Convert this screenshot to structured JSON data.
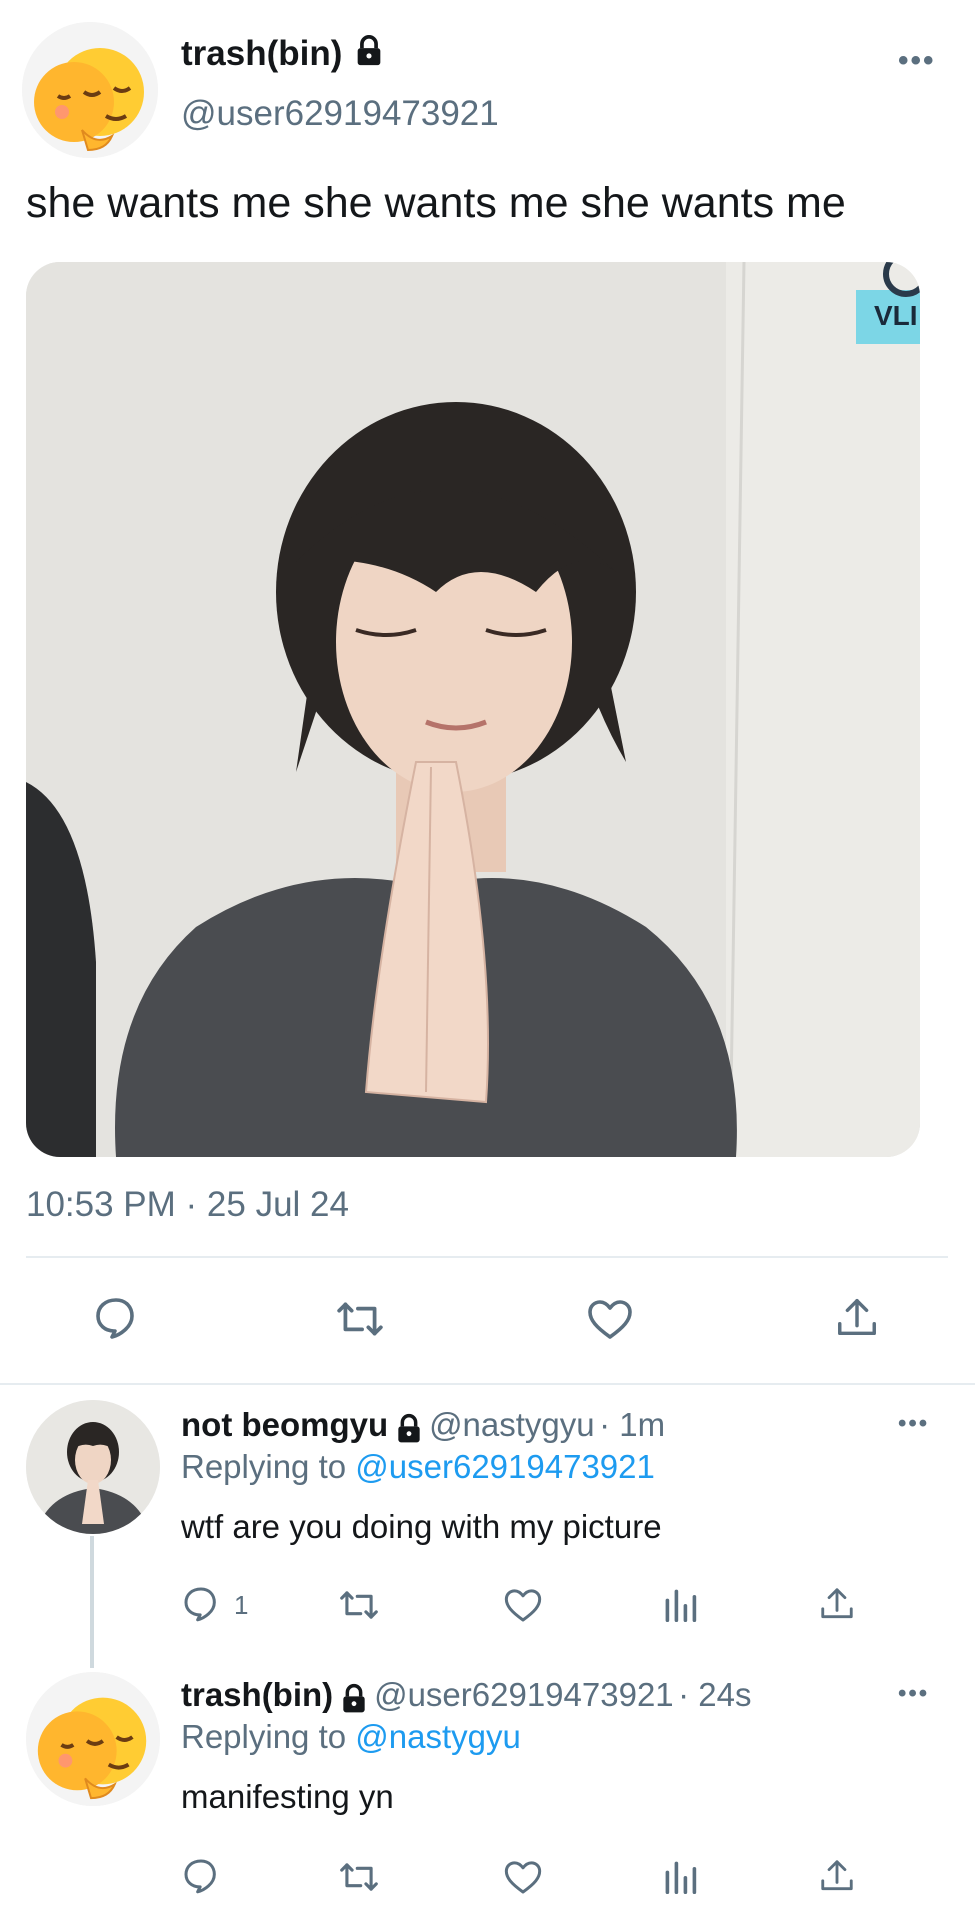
{
  "main_tweet": {
    "display_name": "trash(bin)",
    "handle": "@user62919473921",
    "text": "she wants me she wants me she wants me",
    "media_badge": "VLI",
    "timestamp": "10:53 PM · 25 Jul 24",
    "avatar_icon": "relieved-emoji-avatar",
    "actions": [
      "reply-icon",
      "retweet-icon",
      "like-icon",
      "share-icon"
    ]
  },
  "replies": [
    {
      "display_name": "not beomgyu",
      "handle": "@nastygyu",
      "time": "· 1m",
      "replying_label": "Replying to",
      "replying_to": "@user62919473921",
      "text": "wtf are you doing with my picture",
      "reply_count": "1",
      "actions": [
        "reply-icon",
        "retweet-icon",
        "like-icon",
        "analytics-icon",
        "share-icon"
      ]
    },
    {
      "display_name": "trash(bin)",
      "handle": "@user62919473921",
      "time": "· 24s",
      "replying_label": "Replying to",
      "replying_to": "@nastygyu",
      "text": "manifesting yn",
      "reply_count": "",
      "actions": [
        "reply-icon",
        "retweet-icon",
        "like-icon",
        "analytics-icon",
        "share-icon"
      ]
    }
  ],
  "colors": {
    "text_primary": "#14171a",
    "text_secondary": "#5b6f7f",
    "link": "#1d9bf0",
    "divider": "#e6ecf0"
  }
}
